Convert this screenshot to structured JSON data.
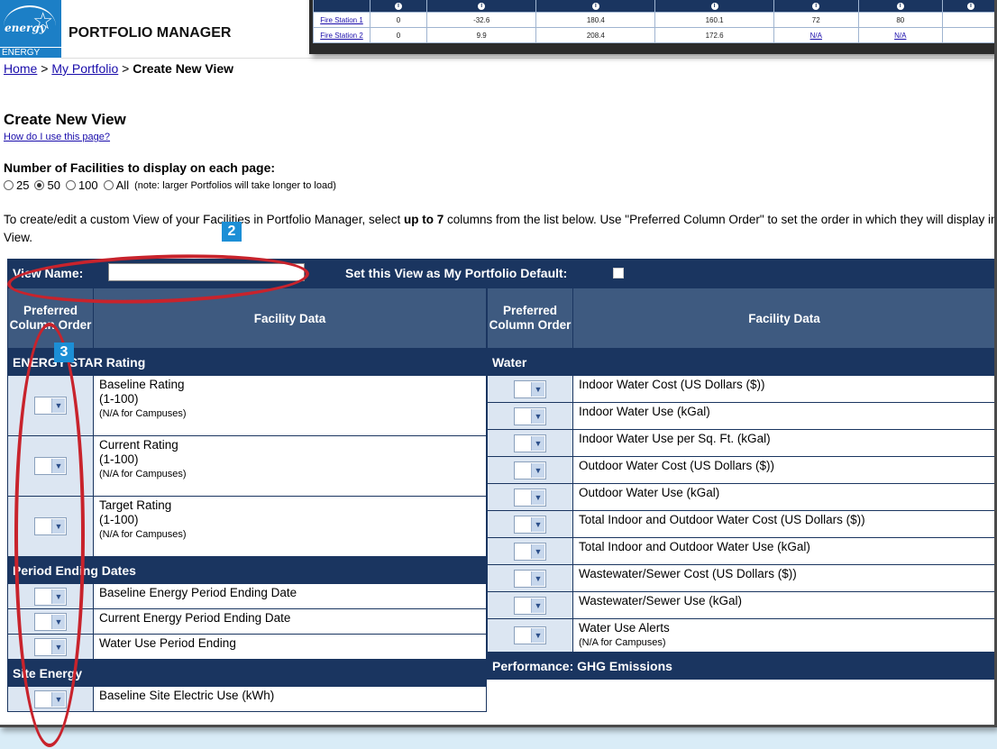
{
  "app": {
    "title": "PORTFOLIO MANAGER",
    "brand": "ENERGY STAR",
    "logo_script": "energy"
  },
  "breadcrumb": {
    "home": "Home",
    "portfolio": "My Portfolio",
    "sep": " > ",
    "current": "Create New View"
  },
  "page": {
    "title": "Create New View",
    "help": "How do I use this page?",
    "facilities_label": "Number of Facilities to display on each page:",
    "options": [
      "25",
      "50",
      "100",
      "All"
    ],
    "selected": "50",
    "options_note": "(note: larger Portfolios will take longer to load)",
    "instructions_prefix": "To create/edit a custom View of your Facilities in Portfolio Manager, select ",
    "instructions_bold": "up to 7",
    "instructions_suffix": " columns from the list below. Use \"Preferred Column Order\" to set the order in which they will display in the View."
  },
  "view_bar": {
    "name_label": "View Name:",
    "name_value": "",
    "default_label": "Set this View as My Portfolio Default:"
  },
  "columns": {
    "order": "Preferred Column Order",
    "facility": "Facility Data"
  },
  "left_sections": [
    {
      "title": "ENERGY STAR Rating",
      "items": [
        {
          "label": "Baseline Rating",
          "range": "(1-100)",
          "note": "(N/A for Campuses)"
        },
        {
          "label": "Current Rating",
          "range": "(1-100)",
          "note": "(N/A for Campuses)"
        },
        {
          "label": "Target Rating",
          "range": "(1-100)",
          "note": "(N/A for Campuses)"
        }
      ]
    },
    {
      "title": "Period Ending Dates",
      "items": [
        {
          "label": "Baseline Energy Period Ending Date"
        },
        {
          "label": "Current Energy Period Ending Date"
        },
        {
          "label": "Water Use Period Ending"
        }
      ]
    },
    {
      "title": "Site Energy",
      "items": [
        {
          "label": "Baseline Site Electric Use (kWh)"
        }
      ]
    }
  ],
  "right_sections": [
    {
      "title": "Water",
      "items": [
        {
          "label": "Indoor Water Cost (US Dollars ($))"
        },
        {
          "label": "Indoor Water Use (kGal)"
        },
        {
          "label": "Indoor Water Use per Sq. Ft. (kGal)"
        },
        {
          "label": "Outdoor Water Cost (US Dollars ($))"
        },
        {
          "label": "Outdoor Water Use (kGal)"
        },
        {
          "label": "Total Indoor and Outdoor Water Cost (US Dollars ($))"
        },
        {
          "label": "Total Indoor and Outdoor Water Use (kGal)"
        },
        {
          "label": "Wastewater/Sewer Cost (US Dollars ($))"
        },
        {
          "label": "Wastewater/Sewer Use (kGal)"
        },
        {
          "label": "Water Use Alerts",
          "note": "(N/A for Campuses)"
        }
      ]
    },
    {
      "title": "Performance: GHG Emissions",
      "items": []
    }
  ],
  "mini_report": {
    "rows": [
      [
        "Fire Station 1",
        "0",
        "-32.6",
        "180.4",
        "160.1",
        "72",
        "80",
        ""
      ],
      [
        "Fire Station 2",
        "0",
        "9.9",
        "208.4",
        "172.6",
        "N/A",
        "N/A",
        ""
      ]
    ]
  },
  "callouts": [
    "2",
    "3"
  ],
  "colors": {
    "header_navy": "#1a3560",
    "column_header": "#3e5a80",
    "accent_blue": "#1c8fd6",
    "annotation_red": "#c8232c"
  }
}
